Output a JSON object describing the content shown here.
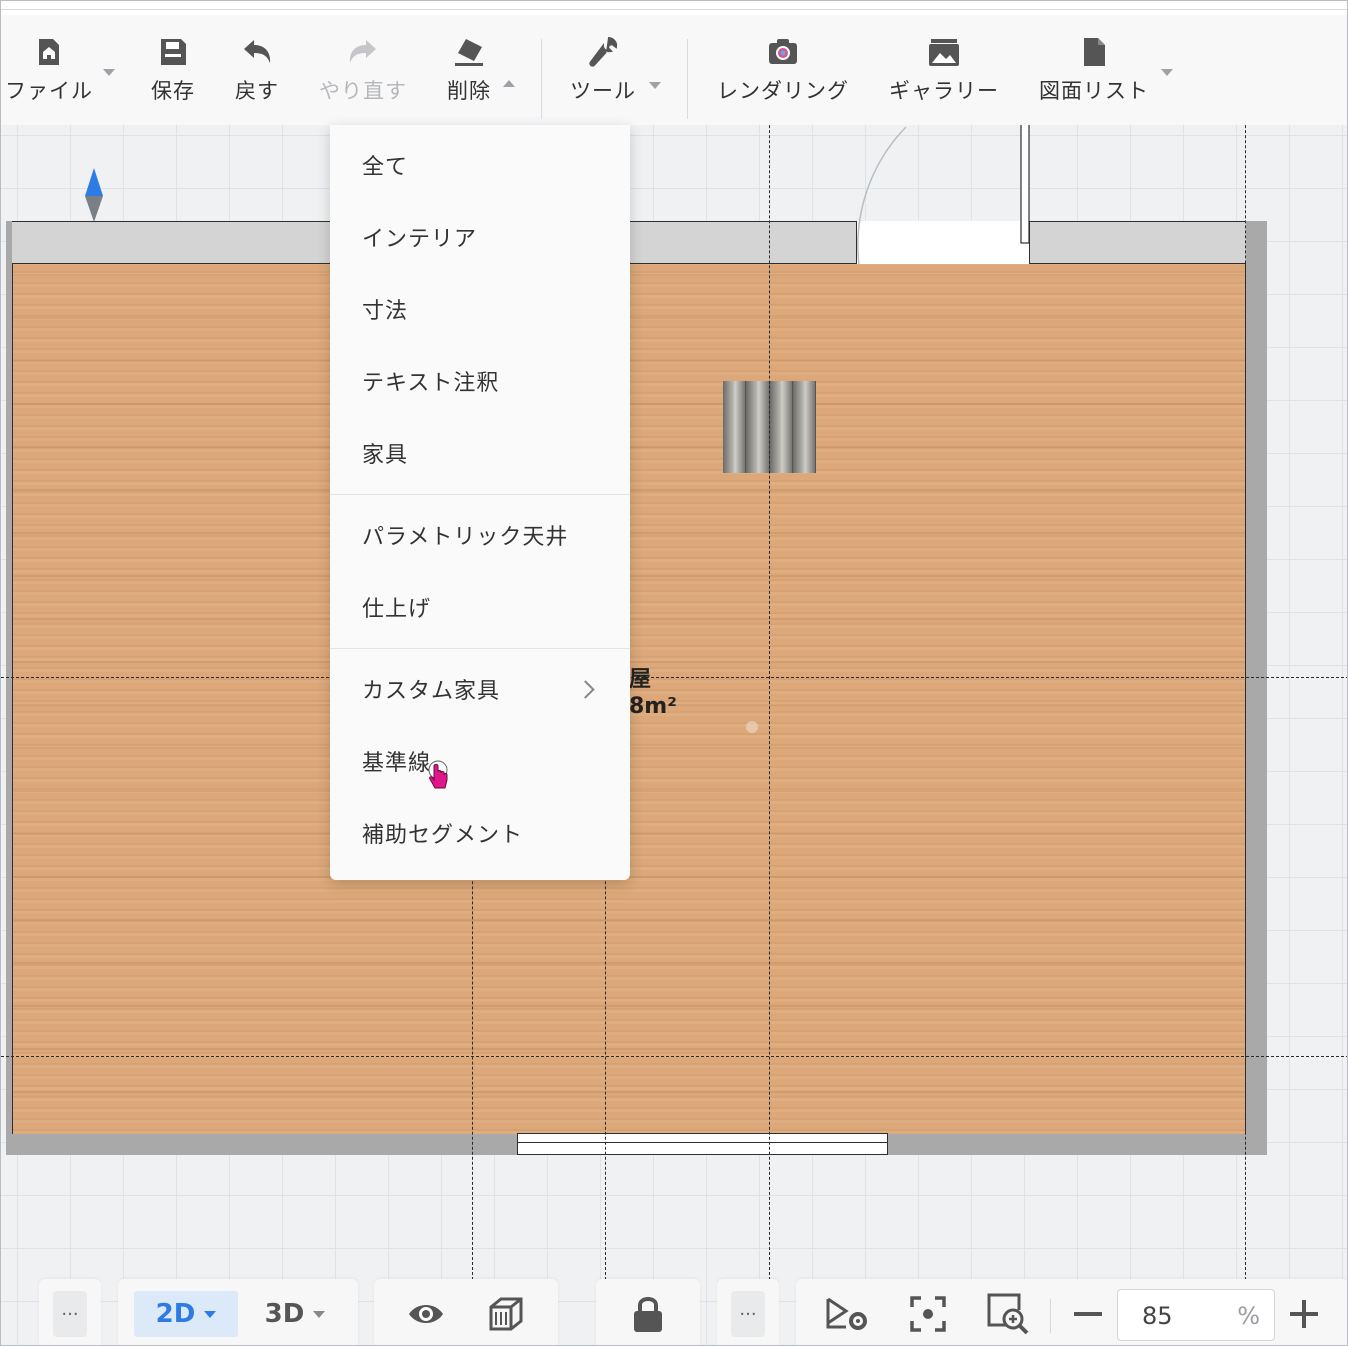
{
  "toolbar": {
    "file_label": "ファイル",
    "save_label": "保存",
    "undo_label": "戻す",
    "redo_label": "やり直す",
    "delete_label": "削除",
    "tools_label": "ツール",
    "render_label": "レンダリング",
    "gallery_label": "ギャラリー",
    "drawing_list_label": "図面リスト"
  },
  "delete_menu": {
    "items": [
      {
        "label": "全て"
      },
      {
        "label": "インテリア"
      },
      {
        "label": "寸法"
      },
      {
        "label": "テキスト注釈"
      },
      {
        "label": "家具"
      },
      {
        "label": "パラメトリック天井"
      },
      {
        "label": "仕上げ"
      },
      {
        "label": "カスタム家具"
      },
      {
        "label": "基準線"
      },
      {
        "label": "補助セグメント"
      }
    ],
    "hovered": "基準線"
  },
  "room": {
    "name_partial": "屋",
    "area_partial": "8m²"
  },
  "bottom_bar": {
    "more_label": "···",
    "view_2d_label": "2D",
    "view_3d_label": "3D",
    "more2_label": "···",
    "zoom_value": "85",
    "zoom_unit": "%",
    "active_view": "2D"
  },
  "colors": {
    "accent": "#2d7be5",
    "active_bg": "#dce9f8",
    "floor": "#dca879",
    "cursor": "#e0178a",
    "compass": "#2d7be5"
  }
}
